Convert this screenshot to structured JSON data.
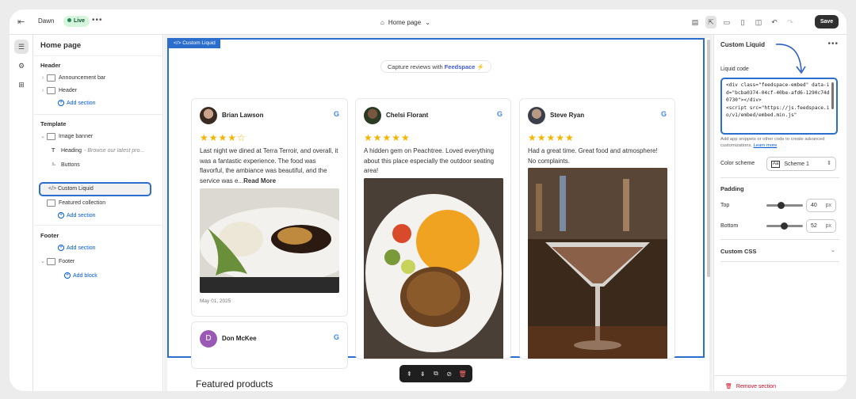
{
  "topbar": {
    "theme_name": "Dawn",
    "live_badge": "Live",
    "page_selector": "Home page",
    "save_label": "Save"
  },
  "sidebar": {
    "title": "Home page",
    "header_group": "Header",
    "header_items": [
      {
        "label": "Announcement bar"
      },
      {
        "label": "Header"
      }
    ],
    "header_add": "Add section",
    "template_group": "Template",
    "image_banner": "Image banner",
    "heading_label": "Heading",
    "heading_sub": "- Browse our latest pro...",
    "buttons_label": "Buttons",
    "custom_liquid": "Custom Liquid",
    "featured_collection": "Featured collection",
    "template_add": "Add section",
    "footer_group": "Footer",
    "footer_add_section": "Add section",
    "footer_item": "Footer",
    "footer_add_block": "Add block"
  },
  "canvas": {
    "block_tag": "Custom Liquid",
    "capture_prefix": "Capture reviews with",
    "capture_brand": "Feedspace",
    "reviews": [
      {
        "name": "Brian Lawson",
        "stars": 4,
        "text": "Last night we dined at Terra Terroir, and overall, it was a fantastic experience. The food was flavorful, the ambiance was beautiful, and the service was e...",
        "read_more": "Read More",
        "date": "May 01, 2025"
      },
      {
        "name": "Chelsi Florant",
        "stars": 5,
        "text": "A hidden gem on Peachtree. Loved everything about this place especially the outdoor seating area!"
      },
      {
        "name": "Steve Ryan",
        "stars": 5,
        "text": "Had a great time. Great food and atmosphere! No complaints."
      },
      {
        "name": "Don McKee",
        "avatar_letter": "D"
      }
    ],
    "featured_products": "Featured products"
  },
  "rpanel": {
    "title": "Custom Liquid",
    "liquid_label": "Liquid code",
    "code": "<div class=\"feedspace-embed\" data-id=\"bcba0374-04cf-40be-afd6-1290c74d0730\"></div>\n<script src=\"https://js.feedspace.io/v1/embed/embed.min.js\"",
    "help_text": "Add app snippets or other code to create advanced customizations.",
    "learn_more": "Learn more",
    "color_scheme_label": "Color scheme",
    "color_scheme_value": "Scheme 1",
    "padding_label": "Padding",
    "top_label": "Top",
    "top_value": "40",
    "bottom_label": "Bottom",
    "bottom_value": "52",
    "unit": "px",
    "custom_css": "Custom CSS",
    "remove": "Remove section"
  },
  "colors": {
    "accent": "#2c6ecb",
    "brand": "#3e59d6",
    "star": "#f5b400",
    "danger": "#c70a24"
  }
}
